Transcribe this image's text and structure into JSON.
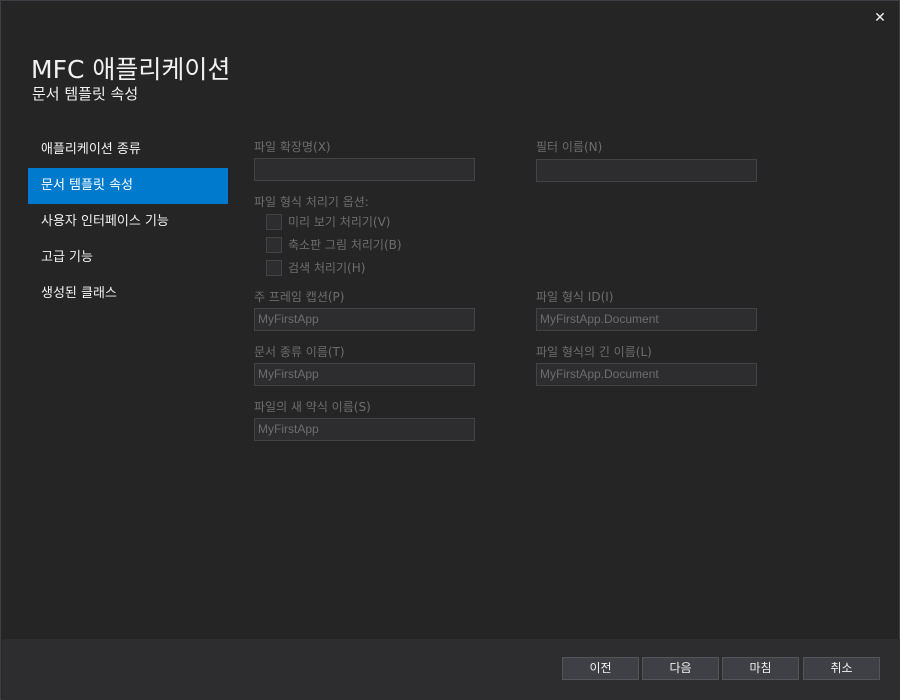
{
  "window": {
    "title": "MFC 애플리케이션",
    "subtitle": "문서 템플릿 속성",
    "close_glyph": "✕"
  },
  "sidebar": {
    "items": [
      {
        "label": "애플리케이션 종류",
        "active": false
      },
      {
        "label": "문서 템플릿 속성",
        "active": true
      },
      {
        "label": "사용자 인터페이스 기능",
        "active": false
      },
      {
        "label": "고급 기능",
        "active": false
      },
      {
        "label": "생성된 클래스",
        "active": false
      }
    ]
  },
  "form": {
    "file_extension": {
      "label": "파일 확장명(X)",
      "value": ""
    },
    "filter_name": {
      "label": "필터 이름(N)",
      "value": ""
    },
    "file_type_options": {
      "label": "파일 형식 처리기 옵션:",
      "preview": {
        "label": "미리 보기 처리기(V)",
        "checked": false
      },
      "thumbnail": {
        "label": "축소판 그림 처리기(B)",
        "checked": false
      },
      "search": {
        "label": "검색 처리기(H)",
        "checked": false
      }
    },
    "main_frame_caption": {
      "label": "주 프레임 캡션(P)",
      "value": "MyFirstApp"
    },
    "file_type_id": {
      "label": "파일 형식 ID(I)",
      "value": "MyFirstApp.Document"
    },
    "doc_type_name": {
      "label": "문서 종류 이름(T)",
      "value": "MyFirstApp"
    },
    "file_type_long_name": {
      "label": "파일 형식의 긴 이름(L)",
      "value": "MyFirstApp.Document"
    },
    "file_new_short_name": {
      "label": "파일의 새 약식 이름(S)",
      "value": "MyFirstApp"
    }
  },
  "footer": {
    "prev_label": "이전",
    "next_label": "다음",
    "finish_label": "마침",
    "cancel_label": "취소"
  },
  "colors": {
    "background": "#252526",
    "accent": "#007acc",
    "disabled_text": "#6d6d6d",
    "footer": "#2d2d30"
  }
}
